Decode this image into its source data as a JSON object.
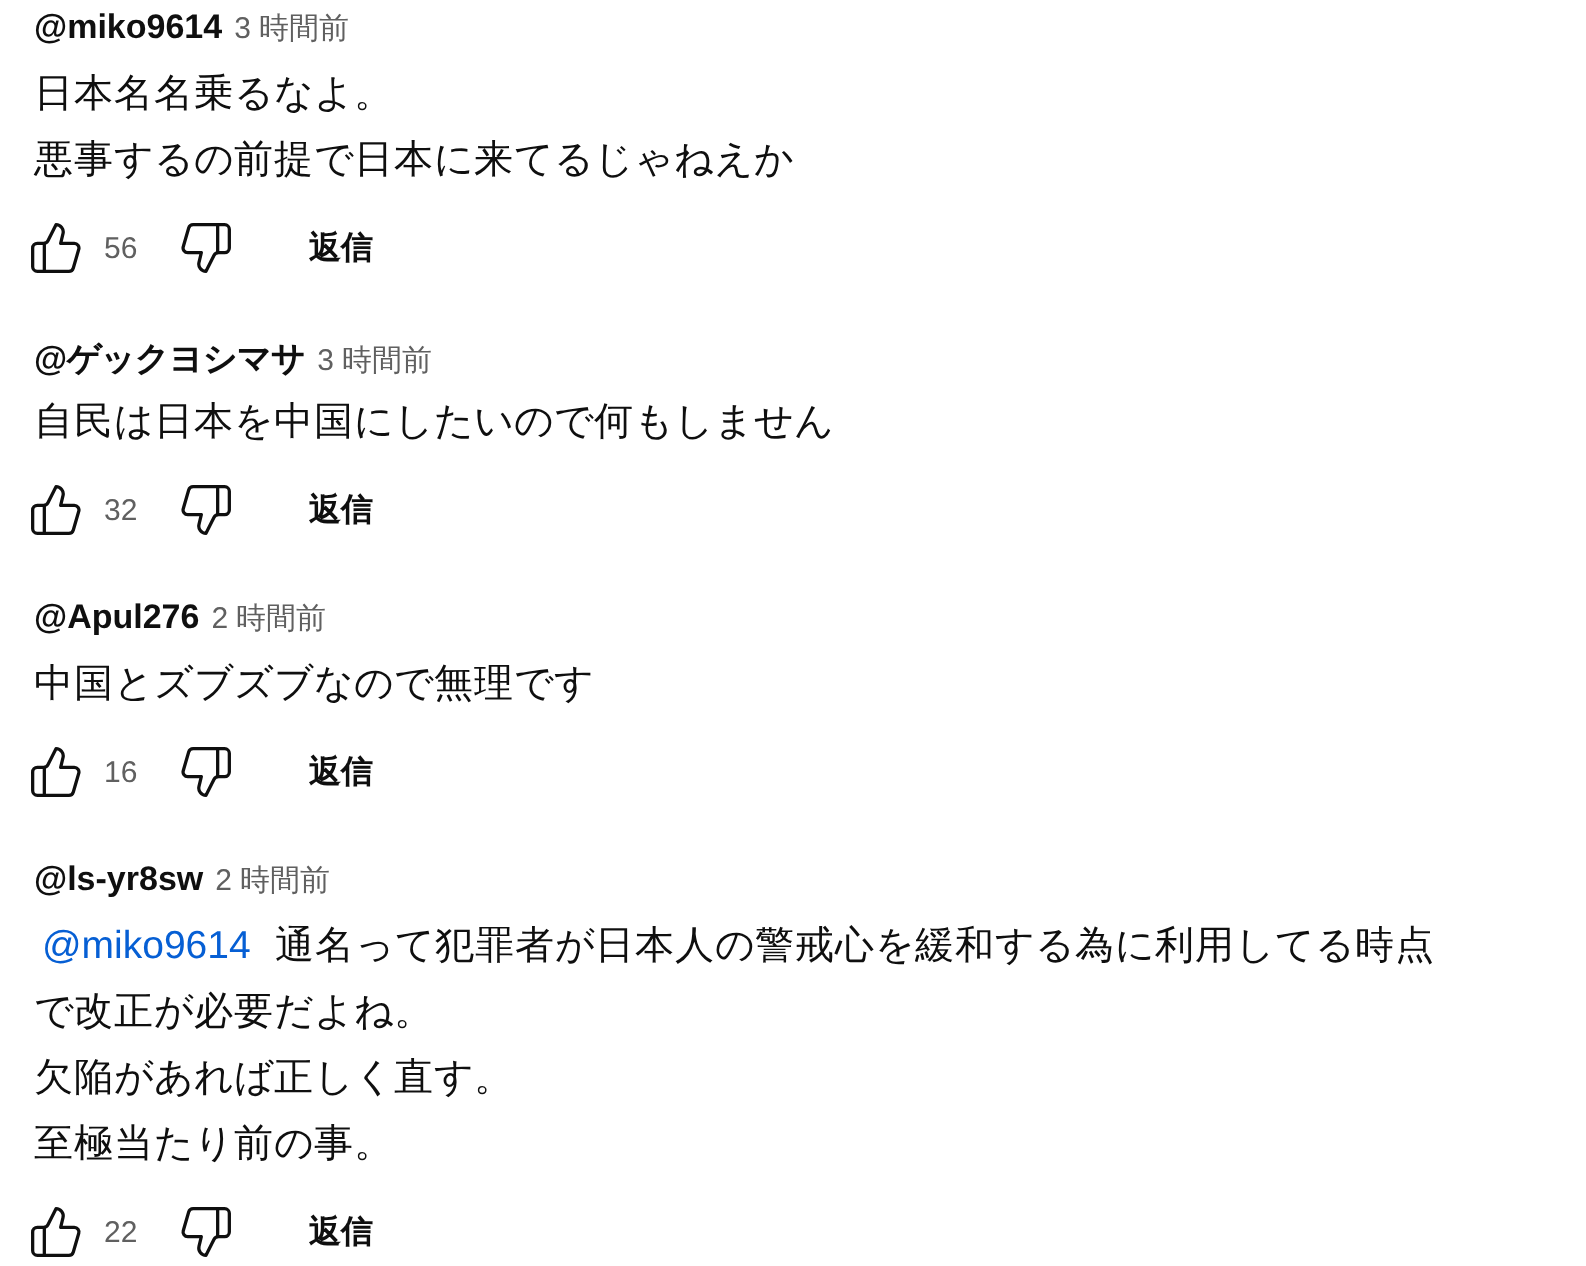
{
  "comments": [
    {
      "author": "@miko9614",
      "time": "3 時間前",
      "lines": [
        "日本名名乗るなよ。",
        "悪事するの前提で日本に来てるじゃねえか"
      ],
      "likes": "56",
      "reply": "返信"
    },
    {
      "author": "@ゲックヨシマサ",
      "time": "3 時間前",
      "lines": [
        "自民は日本を中国にしたいので何もしません"
      ],
      "likes": "32",
      "reply": "返信"
    },
    {
      "author": "@Apul276",
      "time": "2 時間前",
      "lines": [
        "中国とズブズブなので無理です"
      ],
      "likes": "16",
      "reply": "返信"
    },
    {
      "author": "@ls-yr8sw",
      "time": "2 時間前",
      "mention": "@miko9614",
      "lines": [
        "通名って犯罪者が日本人の警戒心を緩和する為に利用してる時点",
        "で改正が必要だよね。",
        "欠陥があれば正しく直す。",
        "至極当たり前の事。"
      ],
      "likes": "22",
      "reply": "返信"
    }
  ]
}
